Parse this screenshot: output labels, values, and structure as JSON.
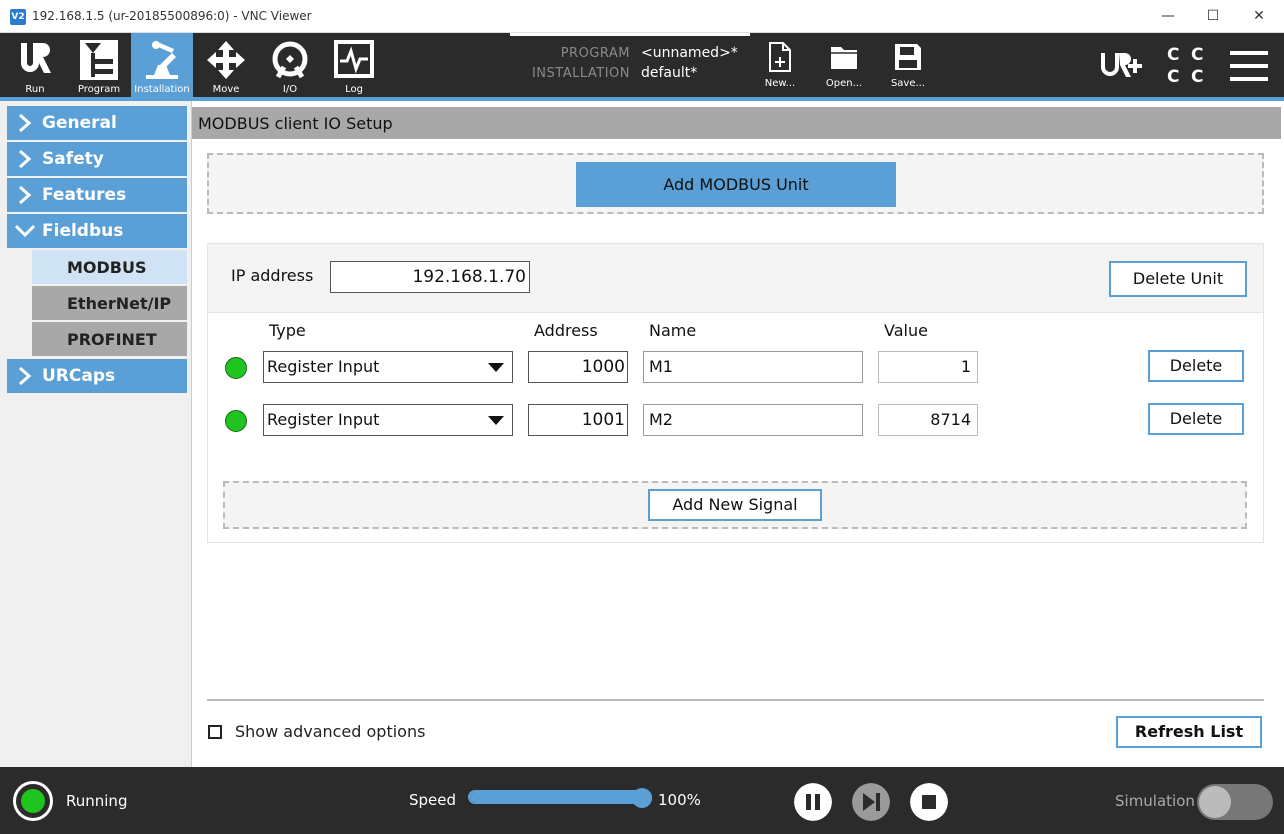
{
  "window": {
    "logo_text": "V2",
    "title": "192.168.1.5 (ur-20185500896:0) - VNC Viewer",
    "minimize": "—",
    "maximize": "☐",
    "close": "✕"
  },
  "header": {
    "nav": [
      {
        "label": "Run",
        "icon": "ur-logo-icon"
      },
      {
        "label": "Program",
        "icon": "program-icon"
      },
      {
        "label": "Installation",
        "icon": "robot-arm-icon"
      },
      {
        "label": "Move",
        "icon": "move-arrows-icon"
      },
      {
        "label": "I/O",
        "icon": "io-icon"
      },
      {
        "label": "Log",
        "icon": "log-icon"
      }
    ],
    "active_nav": "Installation",
    "program_label": "PROGRAM",
    "program_value": "<unnamed>*",
    "installation_label": "INSTALLATION",
    "installation_value": "default*",
    "file_buttons": [
      {
        "label": "New...",
        "icon": "new-file-icon"
      },
      {
        "label": "Open...",
        "icon": "folder-icon"
      },
      {
        "label": "Save...",
        "icon": "save-icon"
      }
    ],
    "cc_letters": [
      "C",
      "C",
      "C",
      "C"
    ]
  },
  "sidebar": {
    "items": [
      {
        "label": "General",
        "expanded": false
      },
      {
        "label": "Safety",
        "expanded": false
      },
      {
        "label": "Features",
        "expanded": false
      },
      {
        "label": "Fieldbus",
        "expanded": true
      },
      {
        "label": "URCaps",
        "expanded": false
      }
    ],
    "fieldbus_children": [
      {
        "label": "MODBUS",
        "active": true
      },
      {
        "label": "EtherNet/IP",
        "active": false
      },
      {
        "label": "PROFINET",
        "active": false
      }
    ]
  },
  "main": {
    "title": "MODBUS client IO Setup",
    "add_unit_label": "Add MODBUS Unit",
    "unit": {
      "ip_label": "IP address",
      "ip_value": "192.168.1.70",
      "delete_unit_label": "Delete Unit",
      "columns": {
        "type": "Type",
        "address": "Address",
        "name": "Name",
        "value": "Value"
      },
      "signals": [
        {
          "type": "Register Input",
          "address": "1000",
          "name": "M1",
          "value": "1",
          "delete_label": "Delete"
        },
        {
          "type": "Register Input",
          "address": "1001",
          "name": "M2",
          "value": "8714",
          "delete_label": "Delete"
        }
      ],
      "add_signal_label": "Add New Signal"
    },
    "show_advanced_label": "Show advanced options",
    "show_advanced_checked": false,
    "refresh_label": "Refresh List"
  },
  "footer": {
    "status": "Running",
    "speed_label": "Speed",
    "speed_value": "100%",
    "speed_fraction": 1.0,
    "simulation_label": "Simulation",
    "simulation_on": false
  },
  "colors": {
    "accent": "#5a9fd6",
    "header_bg": "#2b2b2b",
    "led_green": "#1fc41f"
  }
}
